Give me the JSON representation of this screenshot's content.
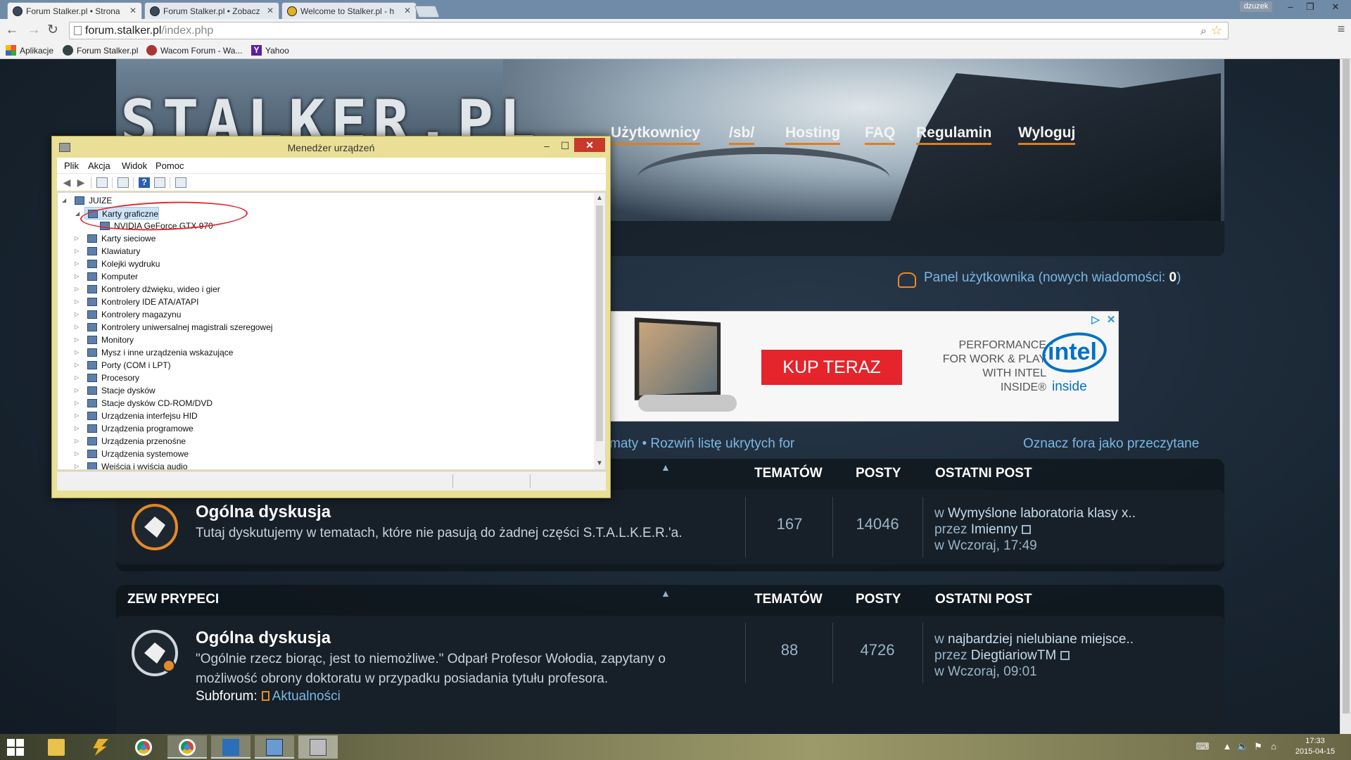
{
  "browser": {
    "tabs": [
      {
        "title": "Forum Stalker.pl • Strona"
      },
      {
        "title": "Forum Stalker.pl • Zobacz"
      },
      {
        "title": "Welcome to Stalker.pl - h"
      }
    ],
    "user_badge": "dzuzek",
    "window_controls": {
      "minimize": "–",
      "maximize": "❐",
      "close": "✕"
    },
    "url_host": "forum.stalker.pl",
    "url_path": "/index.php",
    "bookmarks": [
      {
        "label": "Aplikacje",
        "icon": "apps-grid-icon"
      },
      {
        "label": "Forum Stalker.pl",
        "icon": "stalker-favicon-icon"
      },
      {
        "label": "Wacom Forum - Wa...",
        "icon": "wacom-favicon-icon"
      },
      {
        "label": "Yahoo",
        "icon": "yahoo-favicon-icon"
      }
    ]
  },
  "site": {
    "logo": "STALKER.PL",
    "nav": [
      "Użytkownicy",
      "/sb/",
      "Hosting",
      "FAQ",
      "Regulamin",
      "Wyloguj"
    ],
    "panel_text": "Panel użytkownika (nowych wiadomości: ",
    "panel_count": "0",
    "panel_close": ")",
    "ad": {
      "button": "KUP TERAZ",
      "line1": "PERFORMANCE",
      "line2": "FOR WORK & PLAY",
      "line3": "WITH INTEL",
      "line4": "INSIDE®",
      "intel_word": "intel",
      "intel_inside": "inside",
      "adchoices": "▷",
      "close": "✕"
    },
    "links_left": "maty • Rozwiń listę ukrytych for",
    "links_right": "Oznacz fora jako przeczytane",
    "columns": {
      "topics": "TEMATÓW",
      "posts": "POSTY",
      "last_post": "OSTATNI POST"
    },
    "categories": [
      {
        "title": "",
        "forum": {
          "name": "Ogólna dyskusja",
          "desc": "Tutaj dyskutujemy w tematach, które nie pasują do żadnej części S.T.A.L.K.E.R.'a.",
          "topics": "167",
          "posts": "14046",
          "last_in": "w ",
          "last_topic": "Wymyślone laboratoria klasy x..",
          "last_by": "przez ",
          "last_author": "Imienny",
          "last_when": "w Wczoraj, 17:49"
        }
      },
      {
        "title": "ZEW PRYPECI",
        "forum": {
          "name": "Ogólna dyskusja",
          "desc": "\"Ogólnie rzecz biorąc, jest to niemożliwe.\" Odparł Profesor Wołodia, zapytany o możliwość obrony doktoratu w przypadku posiadania tytułu profesora.",
          "subforum_label": "Subforum:",
          "subforum_link": "Aktualności",
          "topics": "88",
          "posts": "4726",
          "last_in": "w ",
          "last_topic": "najbardziej nielubiane miejsce..",
          "last_by": "przez ",
          "last_author": "DiegtiariowTM",
          "last_when": "w Wczoraj, 09:01"
        }
      }
    ]
  },
  "device_manager": {
    "title": "Menedżer urządzeń",
    "menu": [
      "Plik",
      "Akcja",
      "Widok",
      "Pomoc"
    ],
    "root": "JUIZE",
    "selected_category": "Karty graficzne",
    "gpu": "NVIDIA GeForce GTX 970",
    "categories": [
      "Karty sieciowe",
      "Klawiatury",
      "Kolejki wydruku",
      "Komputer",
      "Kontrolery dźwięku, wideo i gier",
      "Kontrolery IDE ATA/ATAPI",
      "Kontrolery magazynu",
      "Kontrolery uniwersalnej magistrali szeregowej",
      "Monitory",
      "Mysz i inne urządzenia wskazujące",
      "Porty (COM i LPT)",
      "Procesory",
      "Stacje dysków",
      "Stacje dysków CD-ROM/DVD",
      "Urządzenia interfejsu HID",
      "Urządzenia programowe",
      "Urządzenia przenośne",
      "Urządzenia systemowe",
      "Wejścia i wyjścia audio"
    ],
    "annotation_color": "#e4262c"
  },
  "taskbar": {
    "clock_time": "17:33",
    "clock_date": "2015-04-15"
  },
  "colors": {
    "accent_orange": "#e07d1c",
    "link_blue": "#7ab7e5",
    "dm_frame": "#e9df97"
  }
}
